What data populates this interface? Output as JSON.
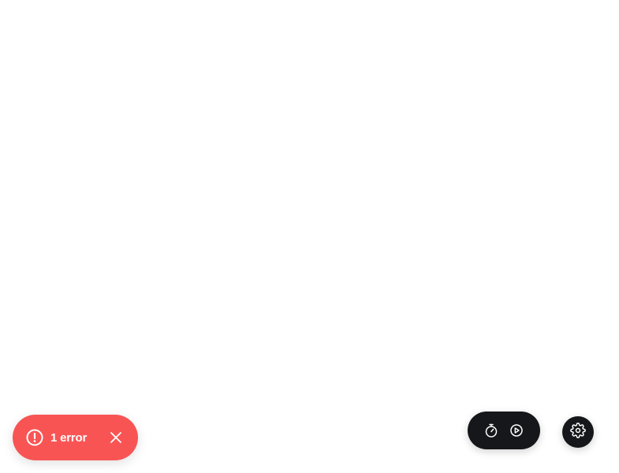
{
  "colors": {
    "background": "#ffffff",
    "error_bg": "#f95454",
    "dark_bg": "#15171a",
    "icon_color": "#ffffff"
  },
  "error_toast": {
    "label": "1 error",
    "icon": "alert-circle-icon",
    "close_icon": "close-icon"
  },
  "toolbar": {
    "items": [
      {
        "icon": "stopwatch-icon"
      },
      {
        "icon": "play-circle-icon"
      }
    ]
  },
  "settings": {
    "icon": "gear-icon"
  }
}
